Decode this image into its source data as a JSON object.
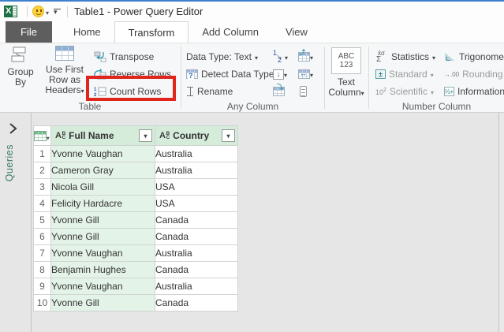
{
  "titlebar": {
    "title": "Table1 - Power Query Editor",
    "icons": [
      "excel-logo",
      "smiley-face",
      "customize-quick-access-toolbar"
    ]
  },
  "tabs": [
    {
      "label": "File",
      "active": false
    },
    {
      "label": "Home",
      "active": false
    },
    {
      "label": "Transform",
      "active": true
    },
    {
      "label": "Add Column",
      "active": false
    },
    {
      "label": "View",
      "active": false
    }
  ],
  "ribbon": {
    "table_group": {
      "label": "Table",
      "group_by": "Group By",
      "use_first_row": "Use First Row as Headers",
      "transpose": "Transpose",
      "reverse_rows": "Reverse Rows",
      "count_rows": "Count Rows",
      "annotation": "red-highlight-on-count-rows"
    },
    "any_column_group": {
      "label": "Any Column",
      "data_type": "Data Type: Text",
      "detect_data_type": "Detect Data Type",
      "rename": "Rename",
      "icon_buttons": [
        "replace-values",
        "unpivot-columns",
        "fill",
        "move",
        "pivot-column",
        "convert-to-list"
      ]
    },
    "text_column_group": {
      "button": "Text Column",
      "icon_top": "ABC",
      "icon_bottom": "123"
    },
    "number_column_group": {
      "label": "Number Column",
      "statistics": "Statistics",
      "standard": "Standard",
      "scientific": "Scientific",
      "trigonometry": "Trigonometry",
      "rounding": "Rounding",
      "information": "Information"
    }
  },
  "sidebar": {
    "label": "Queries",
    "expand_icon": "chevron-right"
  },
  "grid": {
    "columns": [
      {
        "type": "ABC",
        "name": "Full Name"
      },
      {
        "type": "ABC",
        "name": "Country"
      }
    ],
    "rows": [
      [
        1,
        "Yvonne Vaughan",
        "Australia"
      ],
      [
        2,
        "Cameron Gray",
        "Australia"
      ],
      [
        3,
        "Nicola Gill",
        "USA"
      ],
      [
        4,
        "Felicity Hardacre",
        "USA"
      ],
      [
        5,
        "Yvonne Gill",
        "Canada"
      ],
      [
        6,
        "Yvonne Gill",
        "Canada"
      ],
      [
        7,
        "Yvonne Vaughan",
        "Australia"
      ],
      [
        8,
        "Benjamin Hughes",
        "Canada"
      ],
      [
        9,
        "Yvonne Vaughan",
        "Australia"
      ],
      [
        10,
        "Yvonne Gill",
        "Canada"
      ]
    ]
  },
  "colors": {
    "accent_top_border": "#3e7fce",
    "file_tab_bg": "#5e5e5e",
    "header_cell_green": "#d5ecda",
    "data_cell_green": "#e4f3e8",
    "annotation_red": "#e0261c",
    "queries_text": "#3d7b6c"
  }
}
